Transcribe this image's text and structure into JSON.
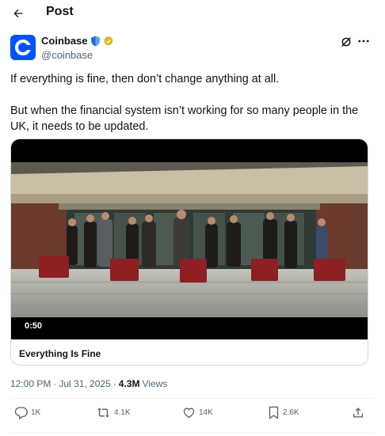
{
  "header": {
    "title": "Post",
    "back_icon": "arrow-left-icon"
  },
  "author": {
    "display_name": "Coinbase",
    "handle": "@coinbase",
    "avatar_color": "#0052ff",
    "badges": [
      "shield-icon",
      "verified-badge-icon"
    ]
  },
  "tweet": {
    "paragraphs": [
      "If everything is fine, then don’t change anything at all.",
      "But when the financial system isn’t working for so many people in the UK, it needs to be updated."
    ]
  },
  "media": {
    "duration": "0:50",
    "card_title": "Everything Is Fine"
  },
  "meta": {
    "time": "12:00 PM",
    "separator": "·",
    "date": "Jul 31, 2025",
    "separator2": "·",
    "views_count": "4.3M",
    "views_label": "Views"
  },
  "actions": {
    "replies": "1K",
    "reposts": "4.1K",
    "likes": "14K",
    "bookmarks": "2.6K"
  },
  "colors": {
    "text_primary": "#0f1419",
    "text_secondary": "#536471",
    "border": "#cfd9de",
    "brand": "#0052ff",
    "verified_gold": "#e2b719",
    "shield_blue": "#1d6fd6"
  }
}
